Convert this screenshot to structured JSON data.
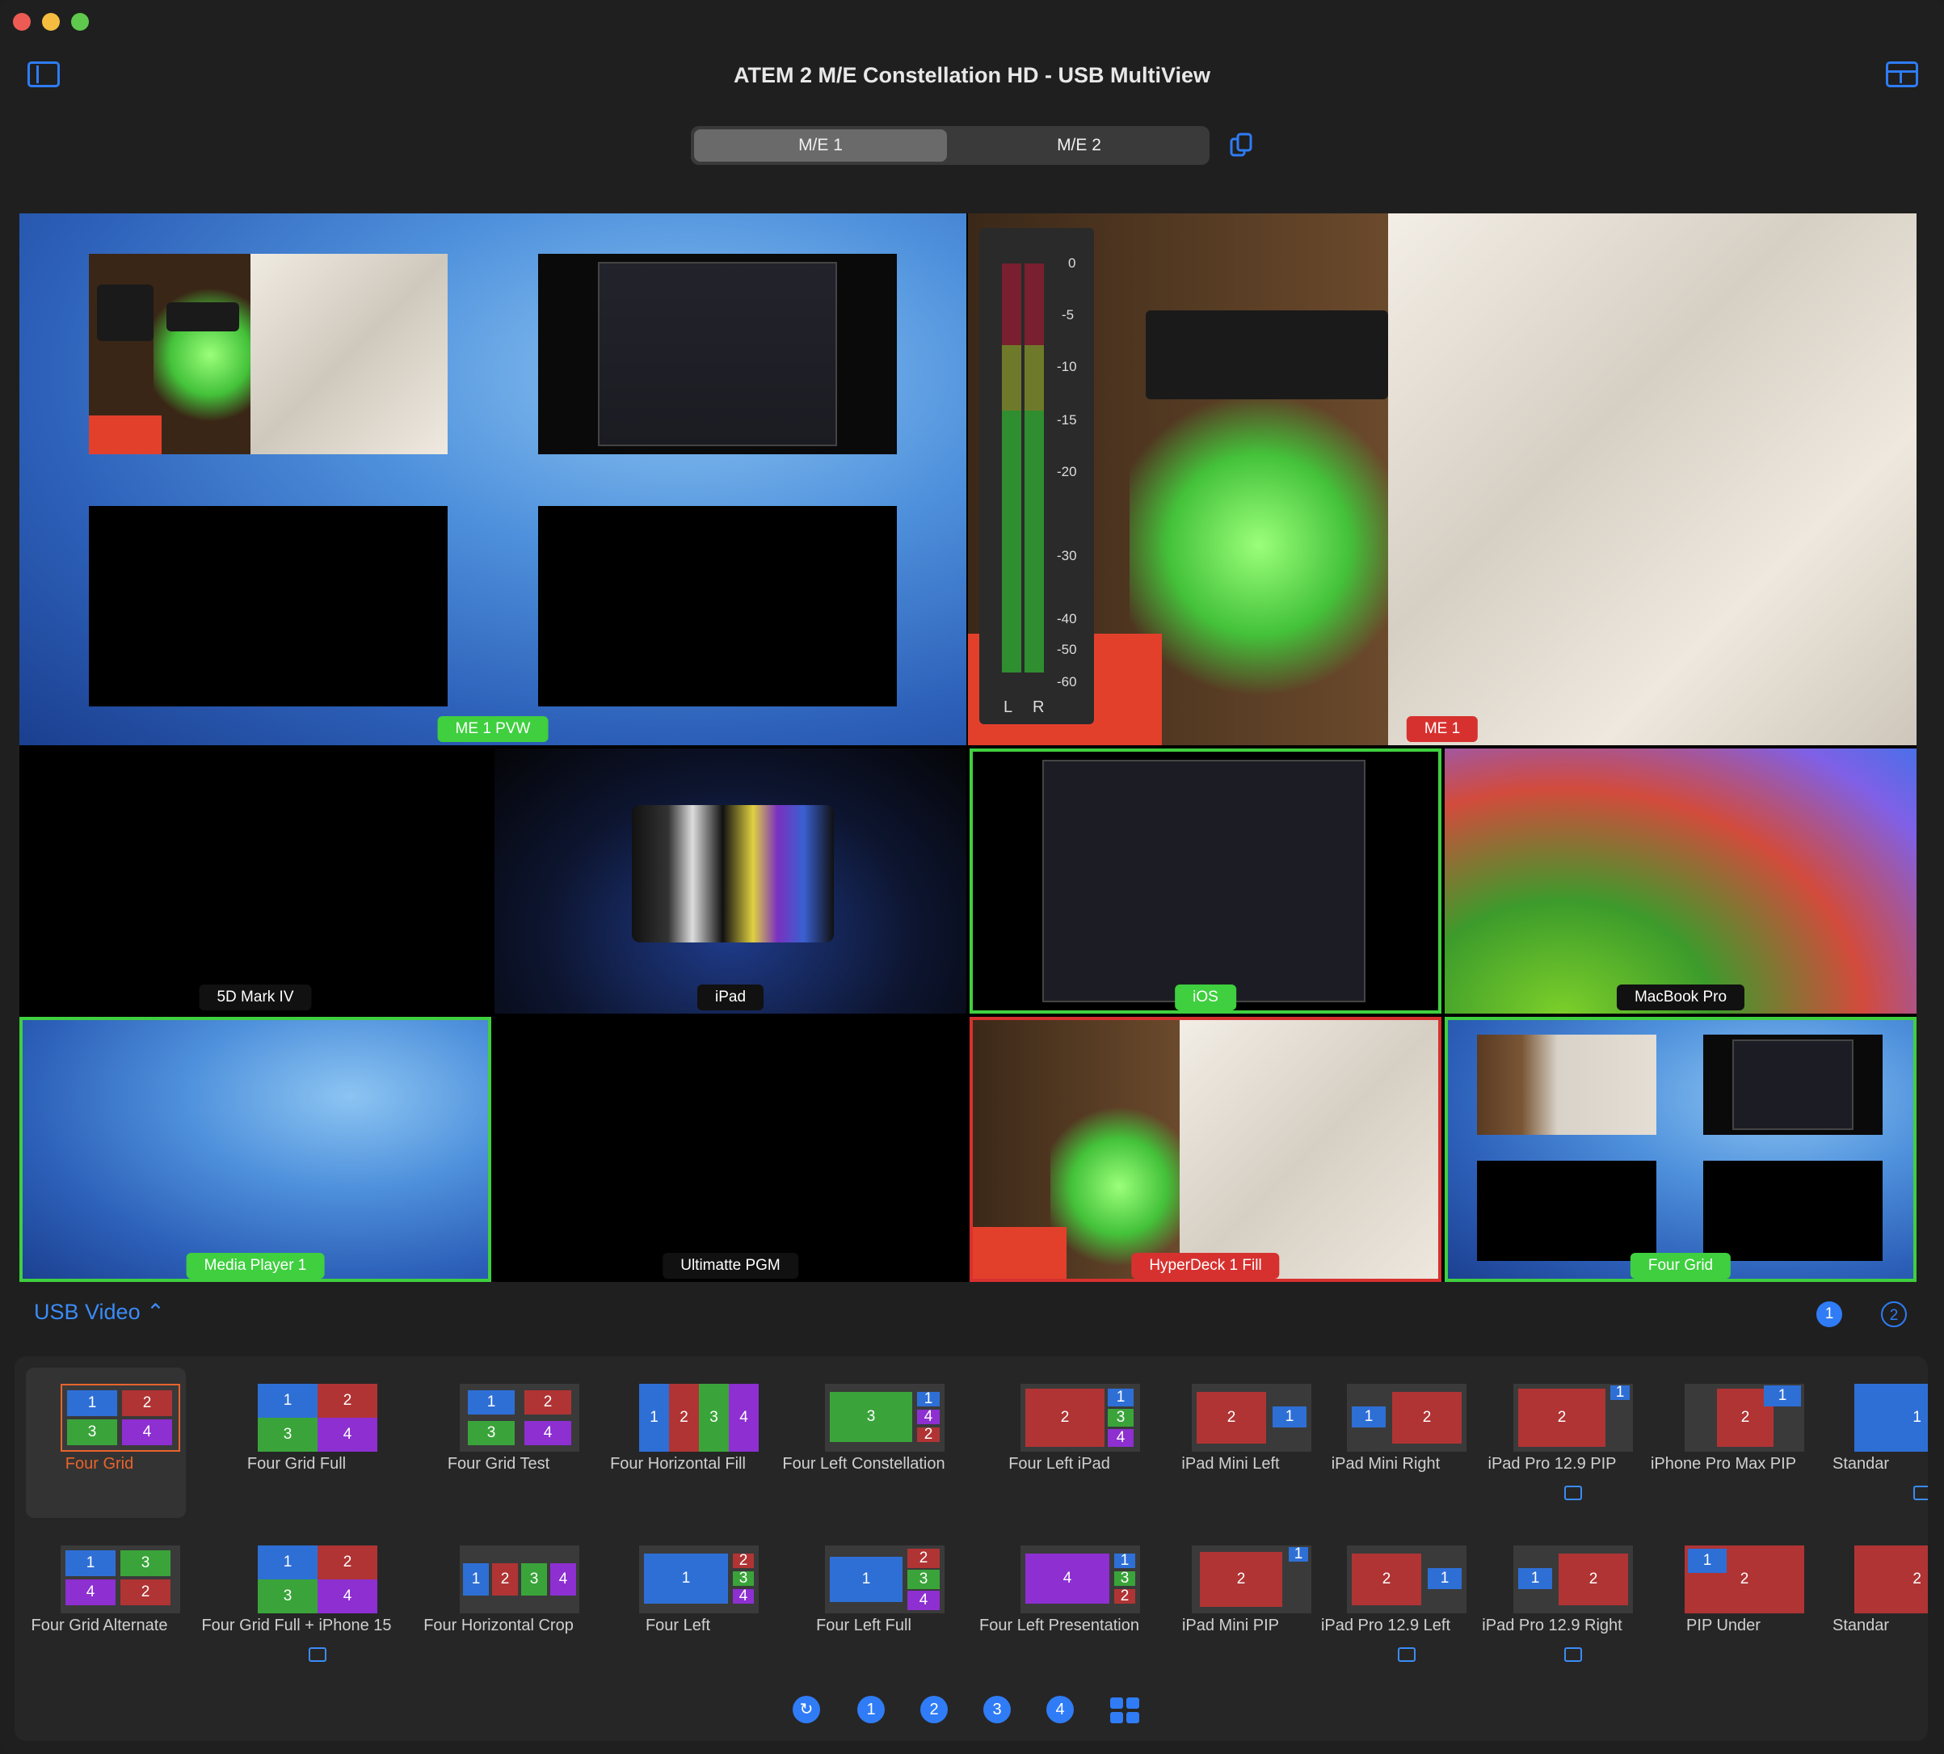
{
  "window": {
    "title": "ATEM 2 M/E Constellation HD - USB MultiView"
  },
  "segments": [
    "M/E 1",
    "M/E 2"
  ],
  "multiview": {
    "top_left": {
      "label": "ME 1 PVW"
    },
    "top_right": {
      "label": "ME 1",
      "meter_scale": [
        "0",
        "-5",
        "-10",
        "-15",
        "-20",
        "-30",
        "-40",
        "-50",
        "-60"
      ],
      "meter_channels": [
        "L",
        "R"
      ]
    },
    "cells": [
      {
        "label": "5D Mark IV"
      },
      {
        "label": "iPad"
      },
      {
        "label": "iOS"
      },
      {
        "label": "MacBook Pro"
      },
      {
        "label": "Media Player 1"
      },
      {
        "label": "Ultimatte PGM"
      },
      {
        "label": "HyperDeck 1 Fill"
      },
      {
        "label": "Four Grid"
      }
    ]
  },
  "source_selector": {
    "label": "USB Video",
    "pages": [
      "1",
      "2"
    ]
  },
  "layouts_row1": [
    "Four Grid",
    "Four Grid Full",
    "Four Grid Test",
    "Four Horizontal Fill",
    "Four Left Constellation",
    "Four Left iPad",
    "iPad Mini Left",
    "iPad Mini Right",
    "iPad Pro 12.9 PIP",
    "iPhone Pro Max PIP",
    "Standar"
  ],
  "layouts_row2": [
    "Four Grid Alternate",
    "Four Grid Full + iPhone 15",
    "Four Horizontal Crop",
    "Four Left",
    "Four Left Full",
    "Four Left Presentation",
    "iPad Mini PIP",
    "iPad Pro 12.9 Left",
    "iPad Pro 12.9 Right",
    "PIP Under",
    "Standar"
  ],
  "bottom_nav": [
    "1",
    "2",
    "3",
    "4"
  ],
  "colors": {
    "accent": "#2f7cf6",
    "tally_green": "#3fcf3f",
    "tally_red": "#d7312f",
    "selected": "#e8642c"
  }
}
